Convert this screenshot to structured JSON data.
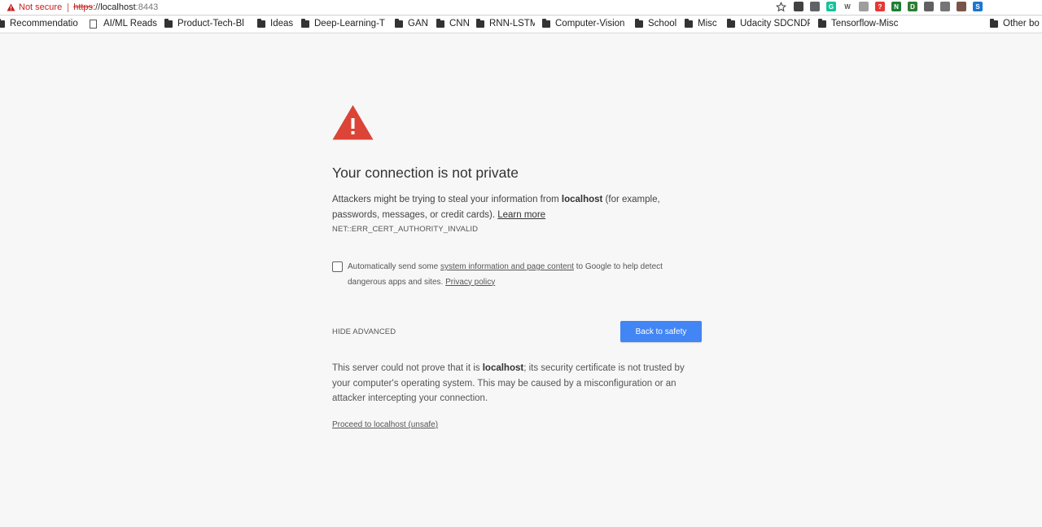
{
  "browser": {
    "security_label": "Not secure",
    "url_scheme": "https",
    "url_sep": "://",
    "url_host": "localhost",
    "url_port": ":8443",
    "extensions": [
      {
        "icon": "ext-dark-icon",
        "color": "#424242",
        "glyph": ""
      },
      {
        "icon": "pocket-icon",
        "color": "#5f6368",
        "glyph": ""
      },
      {
        "icon": "grammarly-icon",
        "color": "#15c39a",
        "glyph": "G"
      },
      {
        "icon": "w-icon",
        "color": "#ffffff",
        "glyph": "W"
      },
      {
        "icon": "ext-gray-icon",
        "color": "#9e9e9e",
        "glyph": ""
      },
      {
        "icon": "ext-red-icon",
        "color": "#e53935",
        "glyph": "?"
      },
      {
        "icon": "ext-green-n-icon",
        "color": "#1e7e34",
        "glyph": "N"
      },
      {
        "icon": "ext-green-circle-icon",
        "color": "#2e7d32",
        "glyph": "D"
      },
      {
        "icon": "ext-gray-square-icon",
        "color": "#616161",
        "glyph": ""
      },
      {
        "icon": "lock-icon",
        "color": "#757575",
        "glyph": ""
      },
      {
        "icon": "ext-badge-icon",
        "color": "#795548",
        "glyph": ""
      },
      {
        "icon": "ext-blue-s-icon",
        "color": "#1976d2",
        "glyph": "S"
      }
    ]
  },
  "bookmarks": [
    {
      "label": "Recommendatio",
      "type": "folder"
    },
    {
      "label": "AI/ML Reads",
      "type": "page"
    },
    {
      "label": "Product-Tech-Bl",
      "type": "folder"
    },
    {
      "label": "Ideas",
      "type": "folder"
    },
    {
      "label": "Deep-Learning-T",
      "type": "folder"
    },
    {
      "label": "GAN",
      "type": "folder"
    },
    {
      "label": "CNN",
      "type": "folder"
    },
    {
      "label": "RNN-LSTM",
      "type": "folder"
    },
    {
      "label": "Computer-Vision",
      "type": "folder"
    },
    {
      "label": "School",
      "type": "folder"
    },
    {
      "label": "Misc",
      "type": "folder"
    },
    {
      "label": "Udacity SDCNDP",
      "type": "folder"
    },
    {
      "label": "Tensorflow-Misc",
      "type": "folder"
    },
    {
      "label": "Other bo",
      "type": "folder"
    }
  ],
  "interstitial": {
    "title": "Your connection is not private",
    "message_pre": "Attackers might be trying to steal your information from ",
    "message_host": "localhost",
    "message_post": " (for example, passwords, messages, or credit cards). ",
    "learn_more": "Learn more",
    "error_code": "NET::ERR_CERT_AUTHORITY_INVALID",
    "optin_pre": "Automatically send some ",
    "optin_link": "system information and page content",
    "optin_post": " to Google to help detect dangerous apps and sites. ",
    "privacy_link": "Privacy policy",
    "hide_advanced": "HIDE ADVANCED",
    "back_button": "Back to safety",
    "details_pre": "This server could not prove that it is ",
    "details_host": "localhost",
    "details_post": "; its security certificate is not trusted by your computer's operating system. This may be caused by a misconfiguration or an attacker intercepting your connection.",
    "proceed_link": "Proceed to localhost (unsafe)"
  },
  "colors": {
    "warning_red": "#db4437",
    "primary_blue": "#4285f4",
    "not_secure_red": "#c5221f",
    "background": "#f7f7f7"
  }
}
